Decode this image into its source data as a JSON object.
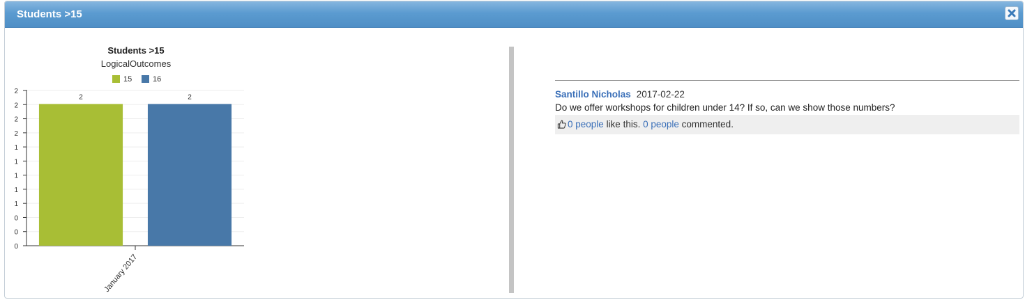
{
  "dialog": {
    "title": "Students >15",
    "close_icon": "close-x-icon"
  },
  "chart_data": {
    "type": "bar",
    "title": "Students >15",
    "subtitle": "LogicalOutcomes",
    "categories": [
      "January 2017"
    ],
    "series": [
      {
        "name": "15",
        "values": [
          2
        ],
        "color": "#a8be35"
      },
      {
        "name": "16",
        "values": [
          2
        ],
        "color": "#4878a8"
      }
    ],
    "data_labels": [
      "2",
      "2"
    ],
    "y_tick_labels": [
      "0",
      "0",
      "0",
      "1",
      "1",
      "1",
      "1",
      "1",
      "2",
      "2",
      "2",
      "2"
    ],
    "ylim": [
      0,
      2.2
    ],
    "legend_position": "top",
    "grid": true,
    "xlabel": "",
    "ylabel": ""
  },
  "comment": {
    "author": "Santillo Nicholas",
    "date": "2017-02-22",
    "text": "Do we offer workshops for children under 14?   If so, can we show those numbers?",
    "likes_link": "0 people",
    "likes_suffix": " like this. ",
    "comments_link": "0 people",
    "comments_suffix": " commented.",
    "like_icon": "thumbs-up-icon"
  }
}
